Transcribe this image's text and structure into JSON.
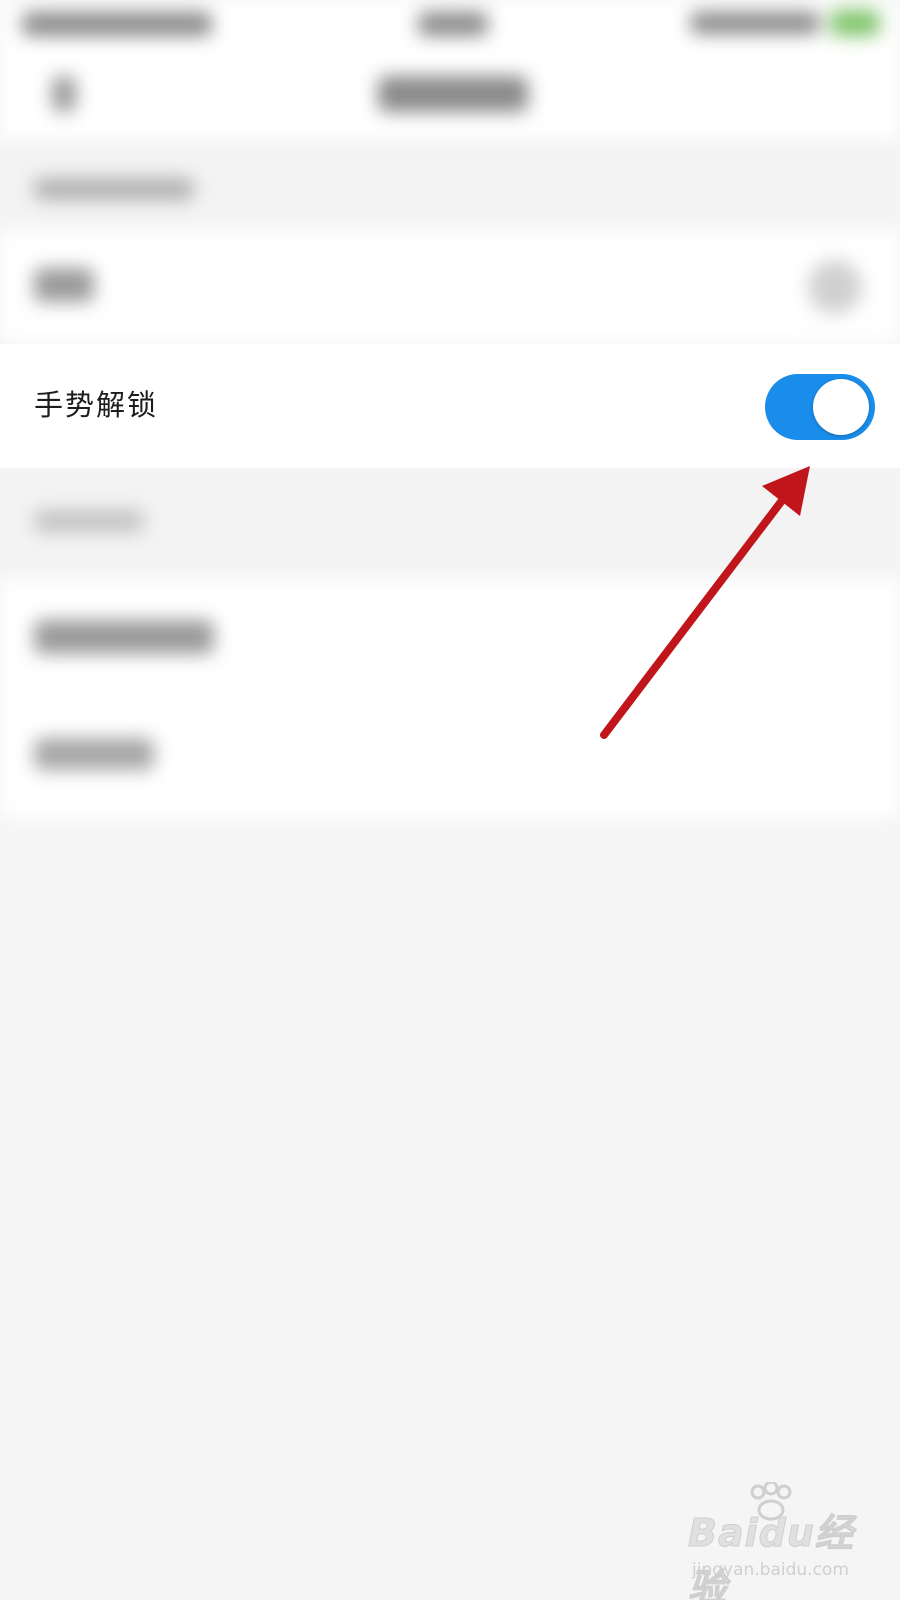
{
  "settings": {
    "gesture_unlock_label": "手势解锁",
    "gesture_unlock_enabled": true
  },
  "colors": {
    "toggle_on": "#1a8cea",
    "annotation_arrow": "#c0151a"
  },
  "icons": {
    "arrow": "annotation-arrow-icon",
    "paw": "baidu-paw-icon"
  },
  "watermark": {
    "brand": "Baidu经验",
    "url": "jingyan.baidu.com"
  }
}
